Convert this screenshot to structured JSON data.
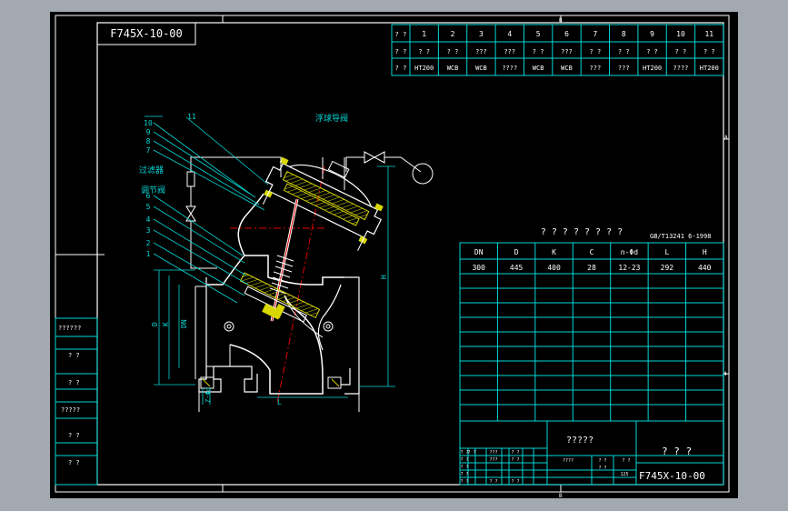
{
  "drawing": {
    "code_mirrored": "F745X-10-00",
    "code": "F745X-10-00",
    "float_valve_label": "浮球导阀",
    "filter_label": "过滤器",
    "regulator_label": "调节阀",
    "standard": "GB/T13241 6-1998",
    "spec_title": "? ? ? ? ? ? ? ?",
    "company": "? ? ?",
    "drawing_name": "?????",
    "frame_marks": {
      "a": "A",
      "b": "B",
      "num4": "4"
    }
  },
  "part_numbers": [
    "1",
    "2",
    "3",
    "4",
    "5",
    "6",
    "7",
    "8",
    "9",
    "10",
    "11"
  ],
  "parts_table": {
    "row_labels": [
      "? ?",
      "? ?",
      "? ?"
    ],
    "numbers": [
      "1",
      "2",
      "3",
      "4",
      "5",
      "6",
      "7",
      "8",
      "9",
      "10",
      "11"
    ],
    "names": [
      "? ?",
      "? ?",
      "???",
      "???",
      "? ?",
      "???",
      "? ?",
      "? ?",
      "? ?",
      "? ?",
      "? ?"
    ],
    "materials": [
      "HT200",
      "WCB",
      "WCB",
      "????",
      "WCB",
      "WCB",
      "???",
      "???",
      "HT200",
      "????",
      "HT200"
    ]
  },
  "dimension_labels": {
    "D": "D",
    "K": "K",
    "DN": "DN",
    "H": "H",
    "L": "L",
    "nd": "Z-Φd"
  },
  "spec_table": {
    "headers": [
      "DN",
      "D",
      "K",
      "C",
      "n-Φd",
      "L",
      "H"
    ],
    "values": [
      "300",
      "445",
      "400",
      "28",
      "12-23",
      "292",
      "440"
    ]
  },
  "side_blocks": [
    "??????",
    "? ?",
    "? ?",
    "?????",
    "? ?",
    "? ?"
  ],
  "title_block": {
    "small_cells": [
      "? ?",
      "? ?",
      "???",
      "? ?",
      "? ?",
      "? ?",
      "? ?",
      "???",
      "? ?",
      "? ?",
      "? ?",
      "? ?"
    ],
    "mid_cells": [
      "????",
      "? ?",
      "? ?",
      "? ?",
      "125"
    ]
  }
}
